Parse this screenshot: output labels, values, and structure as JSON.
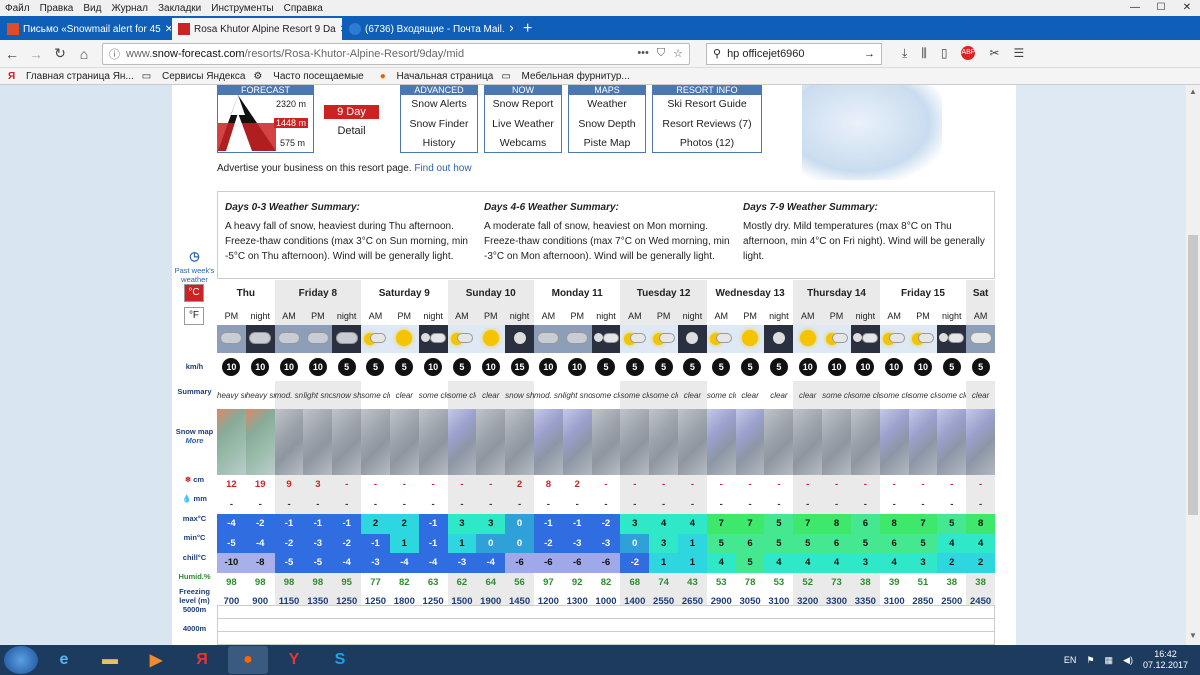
{
  "menu": [
    "Файл",
    "Правка",
    "Вид",
    "Журнал",
    "Закладки",
    "Инструменты",
    "Справка"
  ],
  "tabs": [
    {
      "label": "Письмо «Snowmail alert for 45",
      "active": false
    },
    {
      "label": "Rosa Khutor Alpine Resort 9 Da",
      "active": true
    },
    {
      "label": "(6736) Входящие - Почта Mail.",
      "active": false
    }
  ],
  "url": {
    "prefix": "www.",
    "domain": "snow-forecast.com",
    "path": "/resorts/Rosa-Khutor-Alpine-Resort/9day/mid"
  },
  "search": {
    "value": "hp officejet6960"
  },
  "bookmarks": [
    "Главная страница Ян...",
    "Сервисы Яндекса",
    "Часто посещаемые",
    "Начальная страница",
    "Мебельная фурнитур..."
  ],
  "forecast": {
    "header": "FORECAST",
    "elevations": [
      "2320 m",
      "1448 m",
      "575 m"
    ],
    "nine_day": "9 Day",
    "detail": "Detail"
  },
  "nav": [
    {
      "header": "ADVANCED",
      "items": [
        "Snow Alerts",
        "Snow Finder",
        "History"
      ]
    },
    {
      "header": "NOW",
      "items": [
        "Snow Report",
        "Live Weather",
        "Webcams"
      ]
    },
    {
      "header": "MAPS",
      "items": [
        "Weather",
        "Snow Depth",
        "Piste Map"
      ]
    },
    {
      "header": "RESORT INFO",
      "items": [
        "Ski Resort Guide",
        "Resort Reviews (7)",
        "Photos (12)"
      ]
    }
  ],
  "advert": {
    "text": "Advertise your business on this resort page.",
    "link": "Find out how"
  },
  "summaries": [
    {
      "title": "Days 0-3 Weather Summary:",
      "text": "A heavy fall of snow, heaviest during Thu afternoon. Freeze-thaw conditions (max 3°C on Sun morning, min -5°C on Thu afternoon). Wind will be generally light."
    },
    {
      "title": "Days 4-6 Weather Summary:",
      "text": "A moderate fall of snow, heaviest on Mon morning. Freeze-thaw conditions (max 7°C on Wed morning, min -3°C on Mon afternoon). Wind will be generally light."
    },
    {
      "title": "Days 7-9 Weather Summary:",
      "text": "Mostly dry. Mild temperatures (max 8°C on Thu afternoon, min 4°C on Fri night). Wind will be generally light."
    }
  ],
  "left_labels": {
    "past": "Past week's weather",
    "celsius": "°C",
    "fahrenheit": "°F",
    "wind": "km/h",
    "summary": "Summary",
    "snowmap": "Snow map",
    "more": "More",
    "snow": "cm",
    "rain": "mm",
    "max": "max°C",
    "min": "min°C",
    "chill": "chill°C",
    "humid": "Humid.%",
    "freezing": "Freezing level (m)",
    "alt5000": "5000m",
    "alt4000": "4000m"
  },
  "days": [
    {
      "name": "Thu",
      "span": 2
    },
    {
      "name": "Friday 8",
      "span": 3
    },
    {
      "name": "Saturday 9",
      "span": 3
    },
    {
      "name": "Sunday 10",
      "span": 3
    },
    {
      "name": "Monday 11",
      "span": 3
    },
    {
      "name": "Tuesday 12",
      "span": 3
    },
    {
      "name": "Wednesday 13",
      "span": 3
    },
    {
      "name": "Thursday 14",
      "span": 3
    },
    {
      "name": "Friday 15",
      "span": 3
    },
    {
      "name": "Sat",
      "span": 1
    }
  ],
  "periods": [
    "PM",
    "night",
    "AM",
    "PM",
    "night",
    "AM",
    "PM",
    "night",
    "AM",
    "PM",
    "night",
    "AM",
    "PM",
    "night",
    "AM",
    "PM",
    "night",
    "AM",
    "PM",
    "night",
    "AM",
    "PM",
    "night",
    "AM",
    "PM",
    "night",
    "AM"
  ],
  "weather_icons": [
    "snow",
    "snow-night",
    "snow",
    "snow",
    "snow-night",
    "cloud-sun",
    "sun",
    "cloud-night",
    "cloud-sun",
    "sun",
    "moon",
    "snow",
    "snow",
    "cloud-night",
    "cloud-sun",
    "cloud-sun",
    "moon",
    "cloud-sun",
    "sun",
    "moon",
    "sun",
    "cloud-sun",
    "cloud-night",
    "cloud-sun",
    "cloud-sun",
    "cloud-night",
    "cloud"
  ],
  "wind": [
    "10",
    "10",
    "10",
    "10",
    "5",
    "5",
    "5",
    "10",
    "5",
    "10",
    "15",
    "10",
    "10",
    "5",
    "5",
    "5",
    "5",
    "5",
    "5",
    "5",
    "10",
    "10",
    "10",
    "10",
    "10",
    "5",
    "5"
  ],
  "summary_text": [
    "heavy snow",
    "heavy snow",
    "mod. snow",
    "light snow",
    "snow shwrs",
    "some clouds",
    "clear",
    "some clouds",
    "some clouds",
    "clear",
    "snow shwrs",
    "mod. snow",
    "light snow",
    "some clouds",
    "some clouds",
    "some clouds",
    "clear",
    "some clouds",
    "clear",
    "clear",
    "clear",
    "some clouds",
    "some clouds",
    "some clouds",
    "some clouds",
    "some clouds",
    "clear"
  ],
  "snow_maps": [
    "hot",
    "hot",
    "plain",
    "plain",
    "plain",
    "plain",
    "plain",
    "plain",
    "snow",
    "plain",
    "plain",
    "snow",
    "snow",
    "plain",
    "plain",
    "plain",
    "plain",
    "snow",
    "snow",
    "plain",
    "plain",
    "plain",
    "plain",
    "snow",
    "snow",
    "snow",
    "snow"
  ],
  "snow_cm": [
    "12",
    "19",
    "9",
    "3",
    "-",
    "-",
    "-",
    "-",
    "-",
    "-",
    "2",
    "8",
    "2",
    "-",
    "-",
    "-",
    "-",
    "-",
    "-",
    "-",
    "-",
    "-",
    "-",
    "-",
    "-",
    "-",
    "-"
  ],
  "rain_mm": [
    "-",
    "-",
    "-",
    "-",
    "-",
    "-",
    "-",
    "-",
    "-",
    "-",
    "-",
    "-",
    "-",
    "-",
    "-",
    "-",
    "-",
    "-",
    "-",
    "-",
    "-",
    "-",
    "-",
    "-",
    "-",
    "-",
    "-"
  ],
  "max_c": [
    "-4",
    "-2",
    "-1",
    "-1",
    "-1",
    "2",
    "2",
    "-1",
    "3",
    "3",
    "0",
    "-1",
    "-1",
    "-2",
    "3",
    "4",
    "4",
    "7",
    "7",
    "5",
    "7",
    "8",
    "6",
    "8",
    "7",
    "5",
    "8"
  ],
  "min_c": [
    "-5",
    "-4",
    "-2",
    "-3",
    "-2",
    "-1",
    "1",
    "-1",
    "1",
    "0",
    "0",
    "-2",
    "-3",
    "-3",
    "0",
    "3",
    "1",
    "5",
    "6",
    "5",
    "5",
    "6",
    "5",
    "6",
    "5",
    "4",
    "4"
  ],
  "chill_c": [
    "-10",
    "-8",
    "-5",
    "-5",
    "-4",
    "-3",
    "-4",
    "-4",
    "-3",
    "-4",
    "-6",
    "-6",
    "-6",
    "-6",
    "-2",
    "1",
    "1",
    "4",
    "5",
    "4",
    "4",
    "4",
    "3",
    "4",
    "3",
    "2",
    "2"
  ],
  "humid": [
    "98",
    "98",
    "98",
    "98",
    "95",
    "77",
    "82",
    "63",
    "62",
    "64",
    "56",
    "97",
    "92",
    "82",
    "68",
    "74",
    "43",
    "53",
    "78",
    "53",
    "52",
    "73",
    "38",
    "39",
    "51",
    "38",
    "38"
  ],
  "freezing": [
    "700",
    "900",
    "1150",
    "1350",
    "1250",
    "1250",
    "1800",
    "1250",
    "1500",
    "1900",
    "1450",
    "1200",
    "1300",
    "1000",
    "1400",
    "2550",
    "2650",
    "2900",
    "3050",
    "3100",
    "3200",
    "3300",
    "3350",
    "3100",
    "2850",
    "2500",
    "2450"
  ],
  "colors": {
    "accent": "#4b77b5",
    "red": "#cc2222",
    "tabbar": "#0f5fb8",
    "taskbar": "#1c3b5f"
  },
  "taskbar": {
    "lang": "EN",
    "time": "16:42",
    "date": "07.12.2017"
  }
}
